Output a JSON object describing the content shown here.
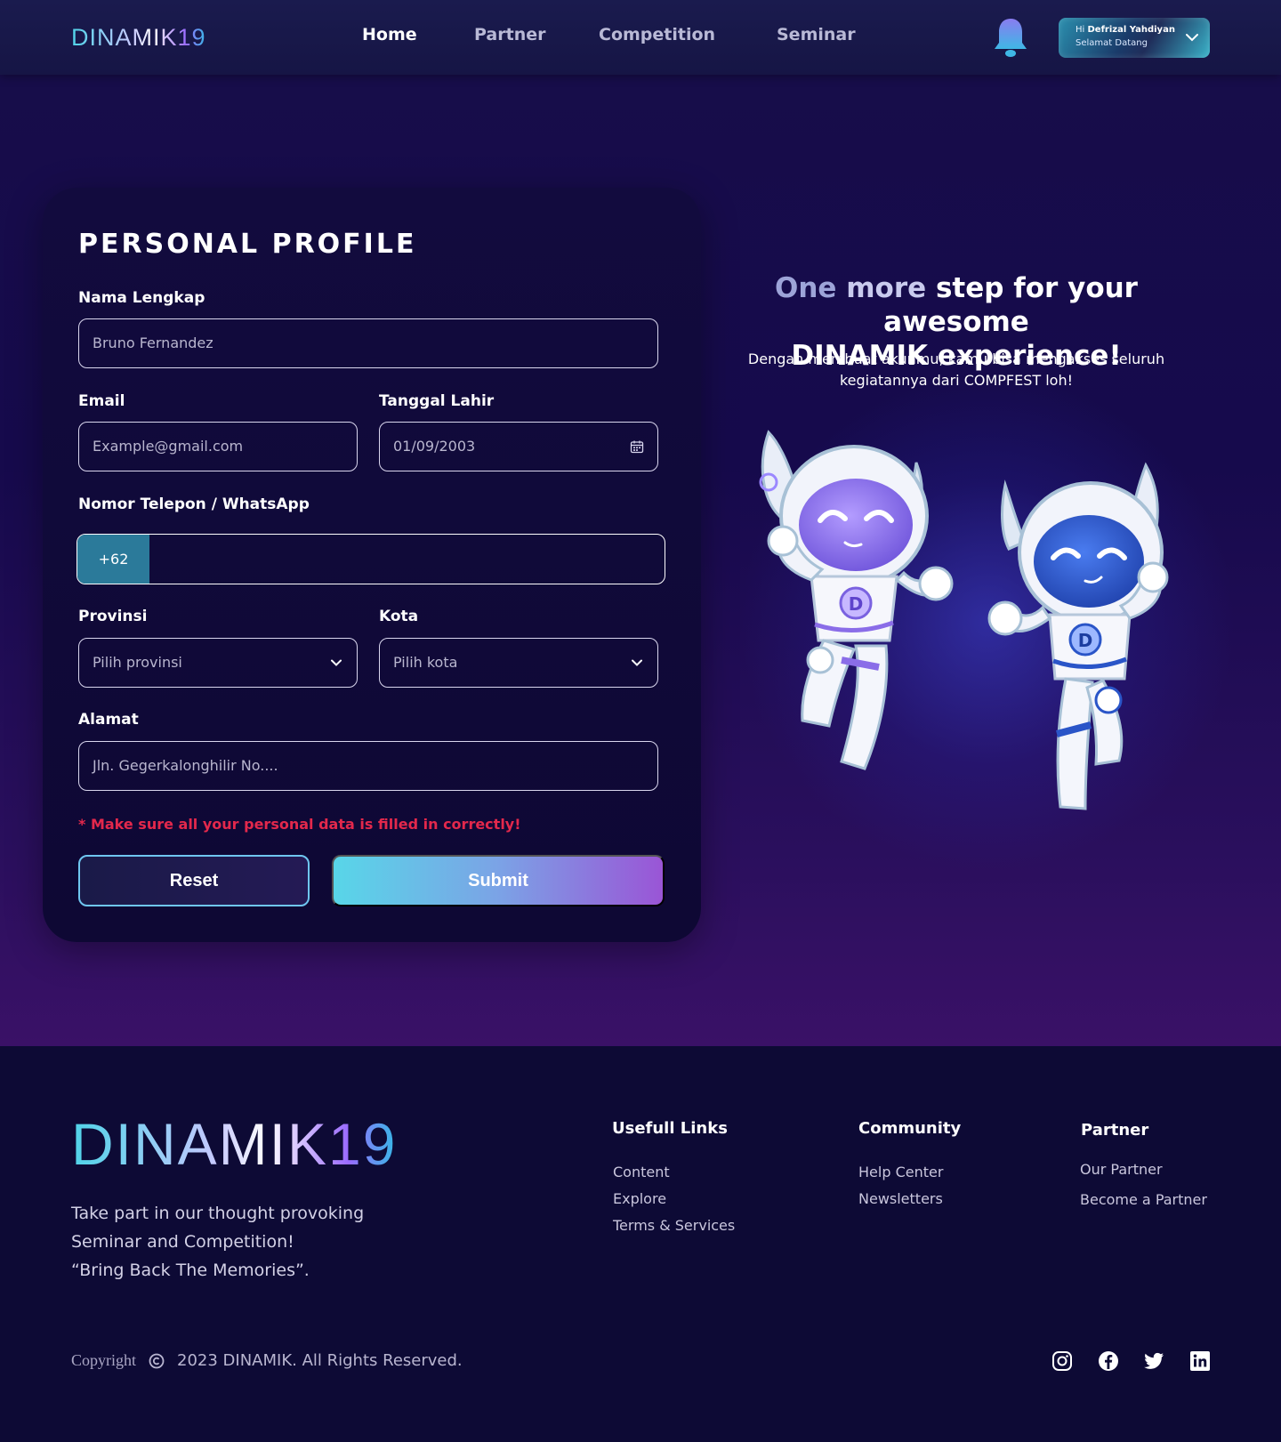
{
  "brand": {
    "logo_text": "DINAMIK19"
  },
  "nav": {
    "links": [
      "Home",
      "Partner",
      "Competition",
      "Seminar"
    ],
    "active": "Home",
    "user": {
      "greeting_prefix": "Hi",
      "name": "Defrizal Yahdiyan",
      "welcome": "Selamat Datang"
    }
  },
  "form": {
    "title": "PERSONAL PROFILE",
    "fields": {
      "name": {
        "label": "Nama Lengkap",
        "value": "Bruno Fernandez"
      },
      "email": {
        "label": "Email",
        "placeholder": "Example@gmail.com"
      },
      "birthdate": {
        "label": "Tanggal Lahir",
        "value": "01/09/2003"
      },
      "phone": {
        "label": "Nomor Telepon / WhatsApp",
        "code": "+62",
        "value": ""
      },
      "province": {
        "label": "Provinsi",
        "placeholder": "Pilih provinsi"
      },
      "city": {
        "label": "Kota",
        "placeholder": "Pilih kota"
      },
      "address": {
        "label": "Alamat",
        "placeholder": "Jln. Gegerkalonghilir No...."
      }
    },
    "warning": "* Make sure all your personal data is filled in correctly!",
    "reset_label": "Reset",
    "submit_label": "Submit"
  },
  "hero": {
    "title_part1": "One ",
    "title_part2": "more ",
    "title_part3": "step for your awesome",
    "title_line2": "DINAMIK experience!",
    "subtitle_line1": "Dengan membuat akunmu, kamu bisa mengakses seluruh",
    "subtitle_line2": "kegiatannya dari COMPFEST loh!"
  },
  "footer": {
    "tagline": [
      "Take part in our thought provoking",
      "Seminar and Competition!",
      "“Bring Back The Memories”."
    ],
    "columns": [
      {
        "heading": "Usefull Links",
        "links": [
          "Content",
          "Explore",
          "Terms & Services"
        ]
      },
      {
        "heading": "Community",
        "links": [
          "Help Center",
          "Newsletters"
        ]
      },
      {
        "heading": "Partner",
        "links": [
          "Our Partner",
          "Become a Partner"
        ]
      }
    ],
    "copyright_word": "Copyright",
    "copyright_text": "2023 DINAMIK. All Rights Reserved.",
    "social_icons": [
      "instagram-icon",
      "facebook-icon",
      "twitter-icon",
      "linkedin-icon"
    ]
  },
  "colors": {
    "accent_cyan": "#58d6e8",
    "accent_purple": "#9a55d6",
    "warning_red": "#e3284c",
    "page_bg": "#170d4a"
  }
}
